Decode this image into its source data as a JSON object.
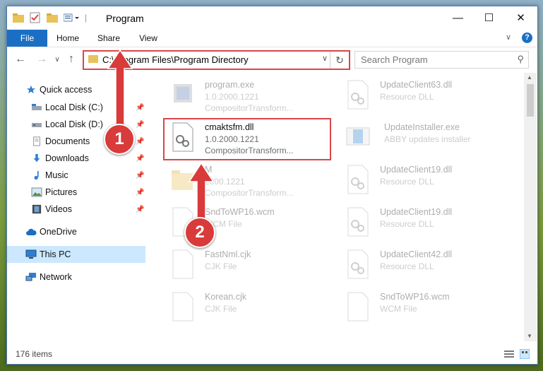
{
  "window": {
    "title": "Program"
  },
  "ribbon": {
    "tabs": [
      "File",
      "Home",
      "Share",
      "View"
    ]
  },
  "address": {
    "path": "C:\\Program Files\\Program Directory"
  },
  "search": {
    "placeholder": "Search Program"
  },
  "nav": {
    "items": [
      {
        "label": "Quick access",
        "icon": "star-icon"
      },
      {
        "label": "Local Disk (C:)",
        "icon": "drive-icon"
      },
      {
        "label": "Local Disk (D:)",
        "icon": "drive-icon"
      },
      {
        "label": "Documents",
        "icon": "documents-icon"
      },
      {
        "label": "Downloads",
        "icon": "downloads-icon"
      },
      {
        "label": "Music",
        "icon": "music-icon"
      },
      {
        "label": "Pictures",
        "icon": "pictures-icon"
      },
      {
        "label": "Videos",
        "icon": "videos-icon"
      },
      {
        "label": "OneDrive",
        "icon": "cloud-icon"
      },
      {
        "label": "This PC",
        "icon": "computer-icon"
      },
      {
        "label": "Network",
        "icon": "network-icon"
      }
    ]
  },
  "files": [
    {
      "name": "program.exe",
      "line1": "1.0.2000.1221",
      "line2": "CompositorTransform..."
    },
    {
      "name": "UpdateClient63.dll",
      "line1": "Resource DLL",
      "line2": ""
    },
    {
      "name": "cmaktsfm.dll",
      "line1": "1.0.2000.1221",
      "line2": "CompositorTransform..."
    },
    {
      "name": "UpdateInstaller.exe",
      "line1": "ABBY updates installer",
      "line2": ""
    },
    {
      "name": "M",
      "line1": "2000.1221",
      "line2": "CompositorTransform..."
    },
    {
      "name": "UpdateClient19.dll",
      "line1": "Resource DLL",
      "line2": ""
    },
    {
      "name": "SndToWP16.wcm",
      "line1": "WCM File",
      "line2": ""
    },
    {
      "name": "UpdateClient19.dll",
      "line1": "Resource DLL",
      "line2": ""
    },
    {
      "name": "FastNml.cjk",
      "line1": "CJK File",
      "line2": ""
    },
    {
      "name": "UpdateClient42.dll",
      "line1": "Resource DLL",
      "line2": ""
    },
    {
      "name": "Korean.cjk",
      "line1": "CJK File",
      "line2": ""
    },
    {
      "name": "SndToWP16.wcm",
      "line1": "WCM File",
      "line2": ""
    }
  ],
  "status": {
    "count": "176 items"
  },
  "annotations": {
    "step1": "1",
    "step2": "2"
  },
  "colors": {
    "accent": "#1a6fc4",
    "highlight": "#d9464a",
    "selected": "#cce8ff"
  }
}
